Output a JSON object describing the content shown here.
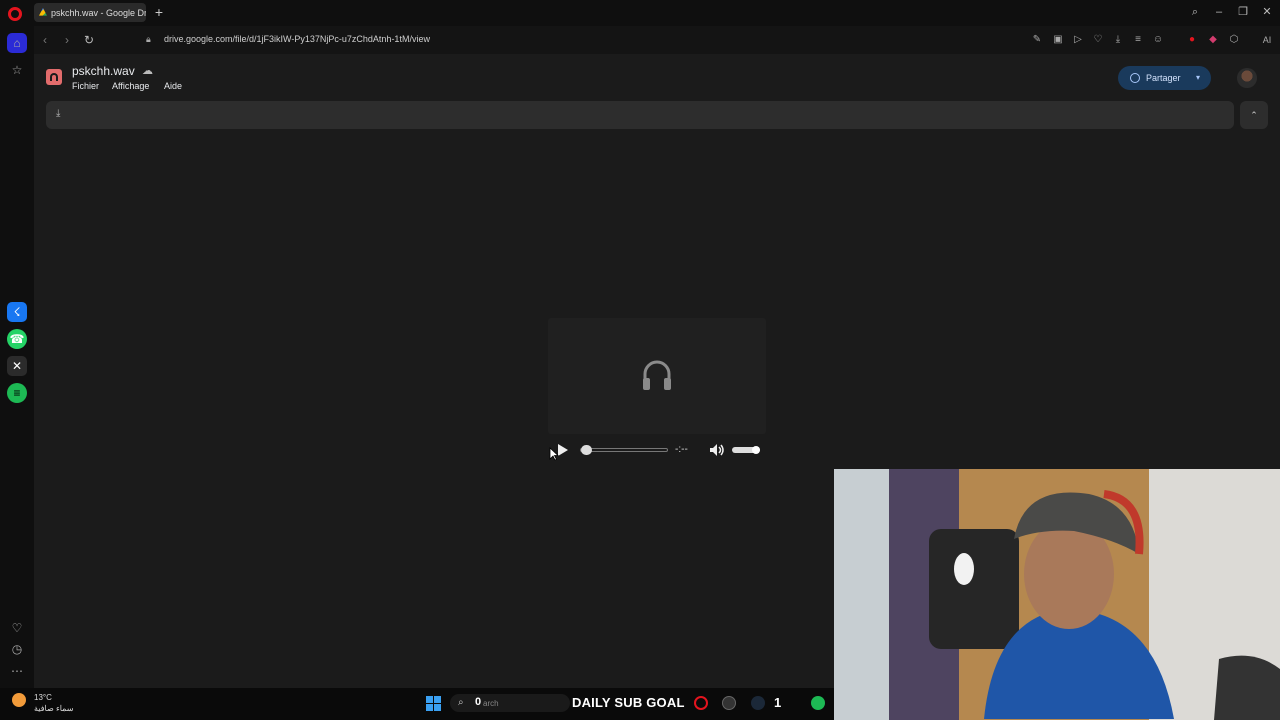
{
  "browser": {
    "tab_title": "pskchh.wav - Google Drive",
    "url": "drive.google.com/file/d/1jF3ikIW-Py137NjPc-u7zChdAtnh-1tM/view",
    "ai_label": "AI",
    "colors": {
      "accent": "#e4141e",
      "chrome": "#0f0f0f"
    }
  },
  "drive": {
    "filename": "pskchh.wav",
    "menu": [
      "Fichier",
      "Affichage",
      "Aide"
    ],
    "share_label": "Partager",
    "colors": {
      "share_bg": "#1a3a5c",
      "page_bg": "#1b1b1b"
    }
  },
  "player": {
    "time": "-:--",
    "progress": 0,
    "volume": 1.0
  },
  "taskbar": {
    "temperature": "13°C",
    "weather_desc": "سماء صافية",
    "search_count": "0",
    "search_placeholder": "arch",
    "sub_goal_label": "DAILY SUB GOAL",
    "sub_goal_value": "1"
  }
}
